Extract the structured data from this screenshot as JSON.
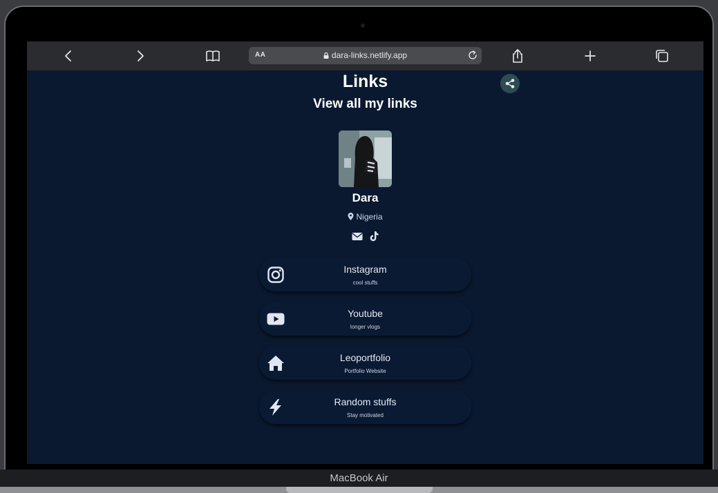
{
  "browser": {
    "aa_label": "AA",
    "url": "dara-links.netlify.app"
  },
  "page": {
    "title": "Links",
    "subtitle": "View all my links"
  },
  "profile": {
    "name": "Dara",
    "location": "Nigeria",
    "socials": [
      "envelope-icon",
      "tiktok-icon"
    ]
  },
  "links": [
    {
      "title": "Instagram",
      "subtitle": "cool stuffs",
      "icon": "instagram-icon"
    },
    {
      "title": "Youtube",
      "subtitle": "longer vlogs",
      "icon": "youtube-icon"
    },
    {
      "title": "Leoportfolio",
      "subtitle": "Portfolio Website",
      "icon": "home-icon"
    },
    {
      "title": "Random stuffs",
      "subtitle": "Stay motivated",
      "icon": "bolt-icon"
    }
  ],
  "device": {
    "label": "MacBook Air"
  },
  "colors": {
    "page_background": "#0a1930",
    "card_background": "#0b1a33",
    "share_button": "#2e4b52",
    "toolbar": "#2b2c2f"
  }
}
